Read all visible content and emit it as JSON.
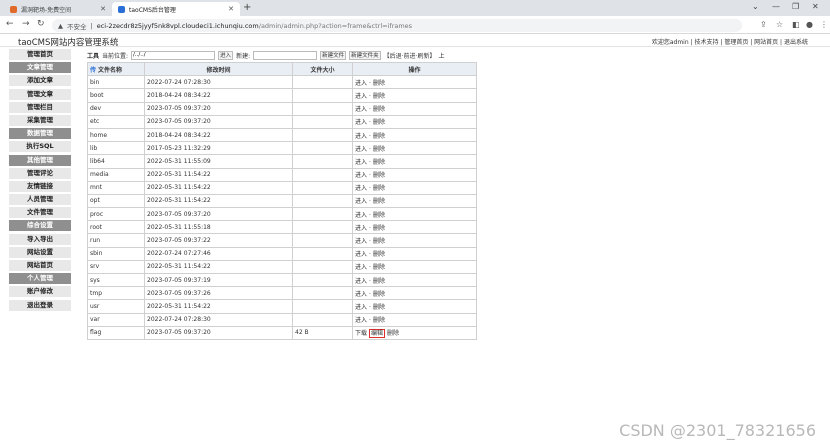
{
  "browser": {
    "tabs": [
      {
        "title": "漏洞靶场-免费空间",
        "color": "#e06a2a"
      },
      {
        "title": "taoCMS后台管理",
        "color": "#2a6fd6"
      }
    ],
    "url_warning": "不安全",
    "url_host": "eci-2zecdr8z5jyyf5nk8vpl.cloudeci1.ichunqiu.com",
    "url_path": "/admin/admin.php?action=frame&ctrl=iframes"
  },
  "app": {
    "title": "taoCMS网站内容管理系统",
    "toplinks": "欢迎您admin | 技术支持 | 管理首页 | 网站首页 | 退出系统"
  },
  "sidebar": [
    {
      "label": "管理首页",
      "type": "item"
    },
    {
      "label": "文章管理",
      "type": "head"
    },
    {
      "label": "添加文章",
      "type": "item"
    },
    {
      "label": "管理文章",
      "type": "item"
    },
    {
      "label": "管理栏目",
      "type": "item"
    },
    {
      "label": "采集管理",
      "type": "item"
    },
    {
      "label": "数据管理",
      "type": "head"
    },
    {
      "label": "执行SQL",
      "type": "item"
    },
    {
      "label": "其他管理",
      "type": "head"
    },
    {
      "label": "管理评论",
      "type": "item"
    },
    {
      "label": "友情链接",
      "type": "item"
    },
    {
      "label": "人员管理",
      "type": "item"
    },
    {
      "label": "文件管理",
      "type": "item"
    },
    {
      "label": "综合设置",
      "type": "head"
    },
    {
      "label": "导入导出",
      "type": "item"
    },
    {
      "label": "网站设置",
      "type": "item"
    },
    {
      "label": "网站首页",
      "type": "item"
    },
    {
      "label": "个人管理",
      "type": "head"
    },
    {
      "label": "账户修改",
      "type": "item"
    },
    {
      "label": "退出登录",
      "type": "item"
    }
  ],
  "toolbar": {
    "tools_label": "工具",
    "location_label": "当前位置:",
    "path_value": "/../../",
    "enter_label": "进入",
    "new_label": "新建:",
    "new_file_label": "新建文件",
    "new_folder_label": "新建文件夹",
    "history_label": "【后退·前进·刷新】",
    "up_label": "上"
  },
  "table": {
    "up_icon": "传",
    "headers": [
      "文件名称",
      "修改时间",
      "文件大小",
      "操作"
    ],
    "rows": [
      {
        "name": "bin",
        "time": "2022-07-24 07:28:30",
        "size": "",
        "actions": [
          "进入",
          "删除"
        ]
      },
      {
        "name": "boot",
        "time": "2018-04-24 08:34:22",
        "size": "",
        "actions": [
          "进入",
          "删除"
        ]
      },
      {
        "name": "dev",
        "time": "2023-07-05 09:37:20",
        "size": "",
        "actions": [
          "进入",
          "删除"
        ]
      },
      {
        "name": "etc",
        "time": "2023-07-05 09:37:20",
        "size": "",
        "actions": [
          "进入",
          "删除"
        ]
      },
      {
        "name": "home",
        "time": "2018-04-24 08:34:22",
        "size": "",
        "actions": [
          "进入",
          "删除"
        ]
      },
      {
        "name": "lib",
        "time": "2017-05-23 11:32:29",
        "size": "",
        "actions": [
          "进入",
          "删除"
        ]
      },
      {
        "name": "lib64",
        "time": "2022-05-31 11:55:09",
        "size": "",
        "actions": [
          "进入",
          "删除"
        ]
      },
      {
        "name": "media",
        "time": "2022-05-31 11:54:22",
        "size": "",
        "actions": [
          "进入",
          "删除"
        ]
      },
      {
        "name": "mnt",
        "time": "2022-05-31 11:54:22",
        "size": "",
        "actions": [
          "进入",
          "删除"
        ]
      },
      {
        "name": "opt",
        "time": "2022-05-31 11:54:22",
        "size": "",
        "actions": [
          "进入",
          "删除"
        ]
      },
      {
        "name": "proc",
        "time": "2023-07-05 09:37:20",
        "size": "",
        "actions": [
          "进入",
          "删除"
        ]
      },
      {
        "name": "root",
        "time": "2022-05-31 11:55:18",
        "size": "",
        "actions": [
          "进入",
          "删除"
        ]
      },
      {
        "name": "run",
        "time": "2023-07-05 09:37:22",
        "size": "",
        "actions": [
          "进入",
          "删除"
        ]
      },
      {
        "name": "sbin",
        "time": "2022-07-24 07:27:46",
        "size": "",
        "actions": [
          "进入",
          "删除"
        ]
      },
      {
        "name": "srv",
        "time": "2022-05-31 11:54:22",
        "size": "",
        "actions": [
          "进入",
          "删除"
        ]
      },
      {
        "name": "sys",
        "time": "2023-07-05 09:37:19",
        "size": "",
        "actions": [
          "进入",
          "删除"
        ]
      },
      {
        "name": "tmp",
        "time": "2023-07-05 09:37:26",
        "size": "",
        "actions": [
          "进入",
          "删除"
        ]
      },
      {
        "name": "usr",
        "time": "2022-05-31 11:54:22",
        "size": "",
        "actions": [
          "进入",
          "删除"
        ]
      },
      {
        "name": "var",
        "time": "2022-07-24 07:28:30",
        "size": "",
        "actions": [
          "进入",
          "删除"
        ]
      },
      {
        "name": "flag",
        "time": "2023-07-05 09:37:20",
        "size": "42 B",
        "actions": [
          "下载",
          "编辑",
          "删除"
        ],
        "highlight": "编辑"
      }
    ]
  },
  "watermark": "CSDN @2301_78321656"
}
